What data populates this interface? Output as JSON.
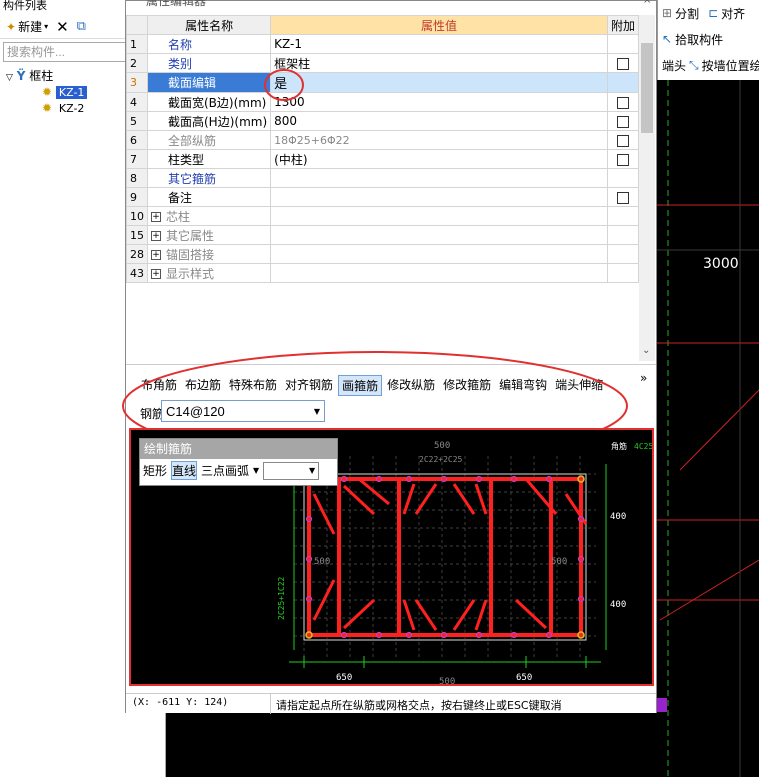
{
  "left_panel": {
    "title": "构件列表",
    "new_button": "新建",
    "search_placeholder": "搜索构件...",
    "tree": {
      "root": "框柱",
      "items": [
        "KZ-1",
        "KZ-2"
      ]
    }
  },
  "right_panel": {
    "row1": {
      "split": "分割",
      "align": "对齐"
    },
    "row2": {
      "pick": "拾取构件"
    },
    "row3": {
      "end": "端头",
      "by_wall": "按墙位置绘"
    }
  },
  "background": {
    "dimension_label": "3000"
  },
  "dialog": {
    "title": "属性编辑器",
    "columns": {
      "name": "属性名称",
      "value": "属性值",
      "extra": "附加"
    },
    "rows": [
      {
        "num": "1",
        "name": "名称",
        "value": "KZ-1",
        "style": "blue",
        "checkbox": false
      },
      {
        "num": "2",
        "name": "类别",
        "value": "框架柱",
        "style": "blue",
        "checkbox": true
      },
      {
        "num": "3",
        "name": "截面编辑",
        "value": "是",
        "style": "selected",
        "checkbox": false
      },
      {
        "num": "4",
        "name": "截面宽(B边)(mm)",
        "value": "1300",
        "style": "normal",
        "checkbox": true
      },
      {
        "num": "5",
        "name": "截面高(H边)(mm)",
        "value": "800",
        "style": "normal",
        "checkbox": true
      },
      {
        "num": "6",
        "name": "全部纵筋",
        "value": "18Φ25+6Φ22",
        "style": "gray",
        "checkbox": true
      },
      {
        "num": "7",
        "name": "柱类型",
        "value": "(中柱)",
        "style": "normal",
        "checkbox": true
      },
      {
        "num": "8",
        "name": "其它箍筋",
        "value": "",
        "style": "blue",
        "checkbox": false
      },
      {
        "num": "9",
        "name": "备注",
        "value": "",
        "style": "normal",
        "checkbox": true
      },
      {
        "num": "10",
        "name": "芯柱",
        "value": "",
        "style": "group",
        "checkbox": false
      },
      {
        "num": "15",
        "name": "其它属性",
        "value": "",
        "style": "group",
        "checkbox": false
      },
      {
        "num": "28",
        "name": "锚固搭接",
        "value": "",
        "style": "group",
        "checkbox": false
      },
      {
        "num": "43",
        "name": "显示样式",
        "value": "",
        "style": "group",
        "checkbox": false
      }
    ],
    "rebar_toolbar": {
      "tabs": [
        "布角筋",
        "布边筋",
        "特殊布筋",
        "对齐钢筋",
        "画箍筋",
        "修改纵筋",
        "修改箍筋",
        "编辑弯钩",
        "端头伸缩"
      ],
      "active_tab": "画箍筋",
      "more": "»",
      "rebar_info_label": "钢筋信息",
      "rebar_info_value": "C14@120"
    },
    "draw_stirrup": {
      "title": "绘制箍筋",
      "buttons": [
        "矩形",
        "直线",
        "三点画弧"
      ],
      "active": "直线"
    },
    "drawing": {
      "top_dim": "500",
      "top_rebar": "2C22+2C25",
      "corner_rebar_label": "角筋",
      "corner_rebar_value": "4C25",
      "left_rebar": "2C25+1C22",
      "left_dim": "500",
      "right_dim": "500",
      "right_dim_upper": "400",
      "right_dim_lower": "400",
      "bottom_dim_left": "650",
      "bottom_dim_center": "500",
      "bottom_dim_right": "650"
    },
    "status": {
      "coords": "(X: -611 Y: 124)",
      "message": "请指定起点所在纵筋或网格交点，按右键终止或ESC键取消"
    }
  },
  "colors": {
    "highlight_ellipse": "#e03030",
    "rebar_red": "#ff2020",
    "dim_green": "#22cc22",
    "node_magenta": "#c040c0"
  }
}
